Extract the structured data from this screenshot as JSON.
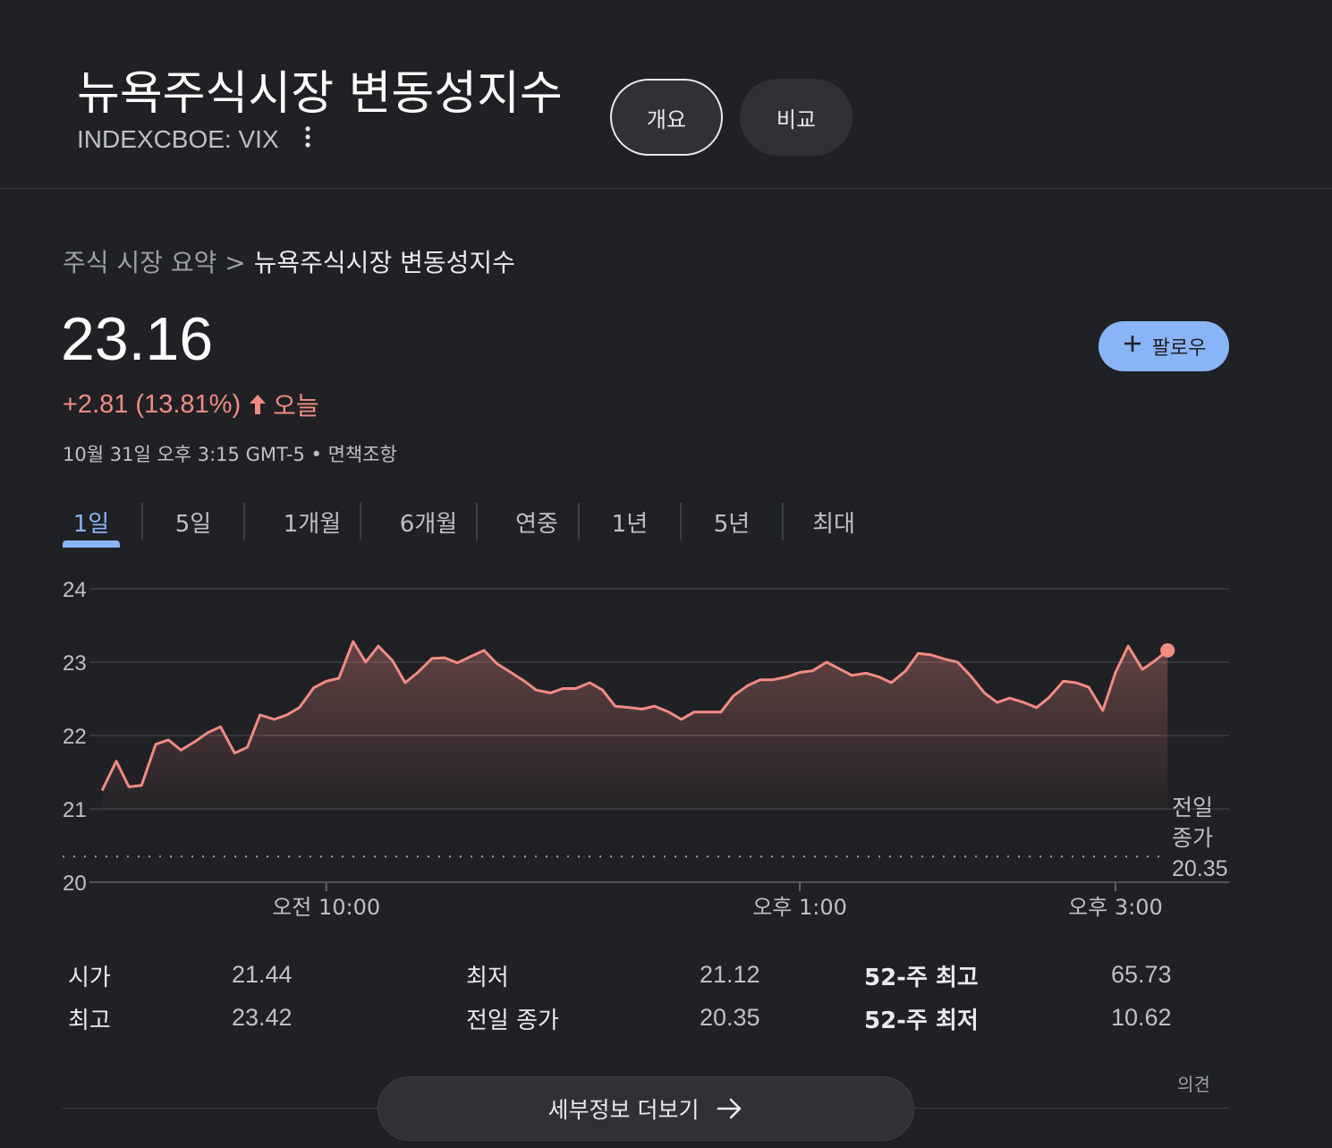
{
  "header": {
    "title": "뉴욕주식시장 변동성지수",
    "ticker": "INDEXCBOE: VIX",
    "buttons": {
      "overview": "개요",
      "compare": "비교"
    }
  },
  "breadcrumb": {
    "parent": "주식 시장 요약",
    "separator": " > ",
    "current": "뉴욕주식시장 변동성지수"
  },
  "quote": {
    "price": "23.16",
    "change": "+2.81 (13.81%)",
    "period": "오늘",
    "timestamp": "10월 31일 오후 3:15 GMT-5",
    "bullet": " • ",
    "disclaimer": "면책조항",
    "follow_label": "팔로우",
    "change_color": "#f28b82"
  },
  "tabs": [
    "1일",
    "5일",
    "1개월",
    "6개월",
    "연중",
    "1년",
    "5년",
    "최대"
  ],
  "active_tab": 0,
  "chart_data": {
    "type": "line",
    "y_ticks": [
      "24",
      "23",
      "22",
      "21",
      "20"
    ],
    "ylim": [
      20,
      24
    ],
    "x_ticks": [
      {
        "label": "오전 10:00",
        "hour": 10.0
      },
      {
        "label": "오후 1:00",
        "hour": 13.0
      },
      {
        "label": "오후 3:00",
        "hour": 15.0
      }
    ],
    "x_range_hours": [
      8.5,
      15.72
    ],
    "previous_close": 20.35,
    "previous_close_label_1": "전일",
    "previous_close_label_2": "종가",
    "previous_close_value": "20.35",
    "line_color": "#f28b82",
    "grid": true,
    "series": [
      {
        "x": [
          8.58,
          8.67,
          8.75,
          8.83,
          8.92,
          9.0,
          9.08,
          9.17,
          9.25,
          9.33,
          9.42,
          9.5,
          9.58,
          9.67,
          9.75,
          9.83,
          9.92,
          10.0,
          10.08,
          10.17,
          10.25,
          10.33,
          10.42,
          10.5,
          10.58,
          10.67,
          10.75,
          10.83,
          10.92,
          11.0,
          11.08,
          11.17,
          11.25,
          11.33,
          11.42,
          11.5,
          11.58,
          11.67,
          11.75,
          11.83,
          11.92,
          12.0,
          12.08,
          12.17,
          12.25,
          12.33,
          12.42,
          12.5,
          12.58,
          12.67,
          12.75,
          12.83,
          12.92,
          13.0,
          13.08,
          13.17,
          13.25,
          13.33,
          13.42,
          13.5,
          13.58,
          13.67,
          13.75,
          13.83,
          13.92,
          14.0,
          14.08,
          14.17,
          14.25,
          14.33,
          14.42,
          14.5,
          14.58,
          14.67,
          14.75,
          14.83,
          14.92,
          15.0,
          15.08,
          15.17,
          15.25
        ],
        "y": [
          21.25,
          21.65,
          21.3,
          21.32,
          21.88,
          21.94,
          21.8,
          21.92,
          22.04,
          22.12,
          21.76,
          21.84,
          22.28,
          22.22,
          22.28,
          22.38,
          22.65,
          22.74,
          22.78,
          23.28,
          23.0,
          23.22,
          23.02,
          22.72,
          22.86,
          23.05,
          23.06,
          22.99,
          23.08,
          23.16,
          22.98,
          22.86,
          22.75,
          22.62,
          22.58,
          22.64,
          22.64,
          22.72,
          22.62,
          22.4,
          22.38,
          22.36,
          22.4,
          22.32,
          22.22,
          22.32,
          22.32,
          22.32,
          22.54,
          22.68,
          22.76,
          22.76,
          22.8,
          22.86,
          22.88,
          23.0,
          22.91,
          22.82,
          22.85,
          22.8,
          22.72,
          22.88,
          23.12,
          23.1,
          23.04,
          23.0,
          22.82,
          22.58,
          22.45,
          22.51,
          22.45,
          22.38,
          22.52,
          22.74,
          22.72,
          22.66,
          22.34,
          22.86,
          23.22,
          22.9,
          23.02
        ],
        "last": {
          "x": 15.33,
          "y": 23.16
        }
      }
    ]
  },
  "stats": [
    {
      "label": "시가",
      "value": "21.44"
    },
    {
      "label": "최저",
      "value": "21.12"
    },
    {
      "label": "52-주 최고",
      "value": "65.73"
    },
    {
      "label": "최고",
      "value": "23.42"
    },
    {
      "label": "전일 종가",
      "value": "20.35"
    },
    {
      "label": "52-주 최저",
      "value": "10.62"
    }
  ],
  "footer": {
    "opinion": "의견",
    "more_details": "세부정보 더보기"
  }
}
